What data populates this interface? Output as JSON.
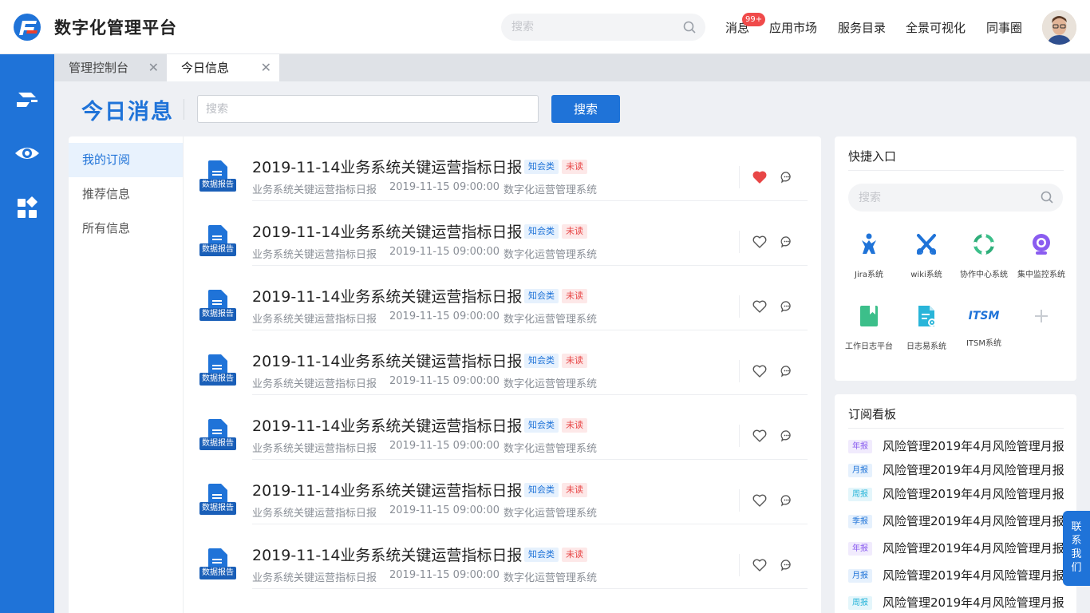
{
  "header": {
    "app_title": "数字化管理平台",
    "search_placeholder": "搜索",
    "nav": [
      "消息",
      "应用市场",
      "服务目录",
      "全景可视化",
      "同事圈"
    ],
    "message_badge": "99+"
  },
  "tabs": [
    {
      "label": "管理控制台"
    },
    {
      "label": "今日信息"
    }
  ],
  "page": {
    "title": "今日消息",
    "search_placeholder": "搜索",
    "search_button": "搜索"
  },
  "subnav": [
    "我的订阅",
    "推荐信息",
    "所有信息"
  ],
  "messages": [
    {
      "icon_label": "数据报告",
      "title": "2019-11-14业务系统关键运营指标日报",
      "category": "知会类",
      "status": "未读",
      "subtitle": "业务系统关键运营指标日报",
      "time": "2019-11-15 09:00:00",
      "source": "数字化运营管理系统",
      "liked": true
    },
    {
      "icon_label": "数据报告",
      "title": "2019-11-14业务系统关键运营指标日报",
      "category": "知会类",
      "status": "未读",
      "subtitle": "业务系统关键运营指标日报",
      "time": "2019-11-15 09:00:00",
      "source": "数字化运营管理系统",
      "liked": false
    },
    {
      "icon_label": "数据报告",
      "title": "2019-11-14业务系统关键运营指标日报",
      "category": "知会类",
      "status": "未读",
      "subtitle": "业务系统关键运营指标日报",
      "time": "2019-11-15 09:00:00",
      "source": "数字化运营管理系统",
      "liked": false
    },
    {
      "icon_label": "数据报告",
      "title": "2019-11-14业务系统关键运营指标日报",
      "category": "知会类",
      "status": "未读",
      "subtitle": "业务系统关键运营指标日报",
      "time": "2019-11-15 09:00:00",
      "source": "数字化运营管理系统",
      "liked": false
    },
    {
      "icon_label": "数据报告",
      "title": "2019-11-14业务系统关键运营指标日报",
      "category": "知会类",
      "status": "未读",
      "subtitle": "业务系统关键运营指标日报",
      "time": "2019-11-15 09:00:00",
      "source": "数字化运营管理系统",
      "liked": false
    },
    {
      "icon_label": "数据报告",
      "title": "2019-11-14业务系统关键运营指标日报",
      "category": "知会类",
      "status": "未读",
      "subtitle": "业务系统关键运营指标日报",
      "time": "2019-11-15 09:00:00",
      "source": "数字化运营管理系统",
      "liked": false
    },
    {
      "icon_label": "数据报告",
      "title": "2019-11-14业务系统关键运营指标日报",
      "category": "知会类",
      "status": "未读",
      "subtitle": "业务系统关键运营指标日报",
      "time": "2019-11-15 09:00:00",
      "source": "数字化运营管理系统",
      "liked": false
    }
  ],
  "quick_entry": {
    "title": "快捷入口",
    "search_placeholder": "搜索",
    "apps": [
      {
        "label": "Jira系统",
        "icon": "jira-icon",
        "color": "#1f73d8"
      },
      {
        "label": "wiki系统",
        "icon": "wiki-icon",
        "color": "#1f73d8"
      },
      {
        "label": "协作中心系统",
        "icon": "sync-icon",
        "color": "#3cbf8a"
      },
      {
        "label": "集中监控系统",
        "icon": "camera-icon",
        "color": "#8a5cf0"
      },
      {
        "label": "工作日志平台",
        "icon": "book-icon",
        "color": "#3cbf8a"
      },
      {
        "label": "日志易系统",
        "icon": "file-gear-icon",
        "color": "#29b5d9"
      },
      {
        "label": "ITSM系统",
        "icon": "itsm-icon",
        "color": "#1f73d8"
      }
    ],
    "itsm_logo_text": "ITSM"
  },
  "subscription_board": {
    "title": "订阅看板",
    "items": [
      {
        "tag": "年报",
        "text": "风险管理2019年4月风险管理月报",
        "tag_color": "#8a5cf0",
        "tag_bg": "#f1ebfd"
      },
      {
        "tag": "月报",
        "text": "风险管理2019年4月风险管理月报",
        "tag_color": "#1f73d8",
        "tag_bg": "#e6f1fd"
      },
      {
        "tag": "周报",
        "text": "风险管理2019年4月风险管理月报",
        "tag_color": "#29b5d9",
        "tag_bg": "#e4f6fb"
      },
      {
        "tag": "季报",
        "text": "风险管理2019年4月风险管理月报",
        "tag_color": "#1f73d8",
        "tag_bg": "#e6f1fd"
      },
      {
        "tag": "年报",
        "text": "风险管理2019年4月风险管理月报",
        "tag_color": "#8a5cf0",
        "tag_bg": "#f1ebfd"
      },
      {
        "tag": "月报",
        "text": "风险管理2019年4月风险管理月报",
        "tag_color": "#1f73d8",
        "tag_bg": "#e6f1fd"
      },
      {
        "tag": "周报",
        "text": "风险管理2019年4月风险管理月报",
        "tag_color": "#29b5d9",
        "tag_bg": "#e4f6fb"
      }
    ]
  },
  "contact_button": "联系我们",
  "colors": {
    "primary": "#1f73d8",
    "danger": "#e84646"
  }
}
